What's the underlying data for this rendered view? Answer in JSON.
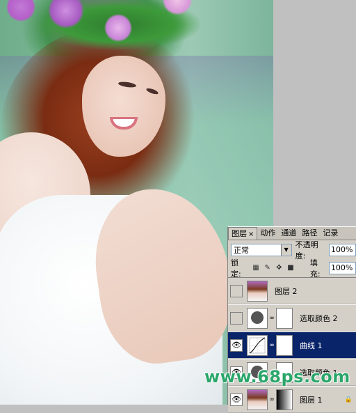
{
  "watermark": "www.68ps.com",
  "panel": {
    "tabs": [
      {
        "label": "图层",
        "active": true,
        "close": "×"
      },
      {
        "label": "动作",
        "active": false
      },
      {
        "label": "通道",
        "active": false
      },
      {
        "label": "路径",
        "active": false
      },
      {
        "label": "记录",
        "active": false
      }
    ],
    "blend_mode": "正常",
    "opacity_label": "不透明度:",
    "opacity_value": "100%",
    "lock_label": "锁定:",
    "fill_label": "填充:",
    "fill_value": "100%",
    "layers": [
      {
        "name": "图层 2",
        "visible": false,
        "selected": false
      },
      {
        "name": "选取颜色 2",
        "visible": false,
        "selected": false
      },
      {
        "name": "曲线 1",
        "visible": true,
        "selected": true
      },
      {
        "name": "选取颜色 1",
        "visible": true,
        "selected": false
      },
      {
        "name": "图层 1",
        "visible": true,
        "selected": false,
        "locked": true
      }
    ]
  }
}
